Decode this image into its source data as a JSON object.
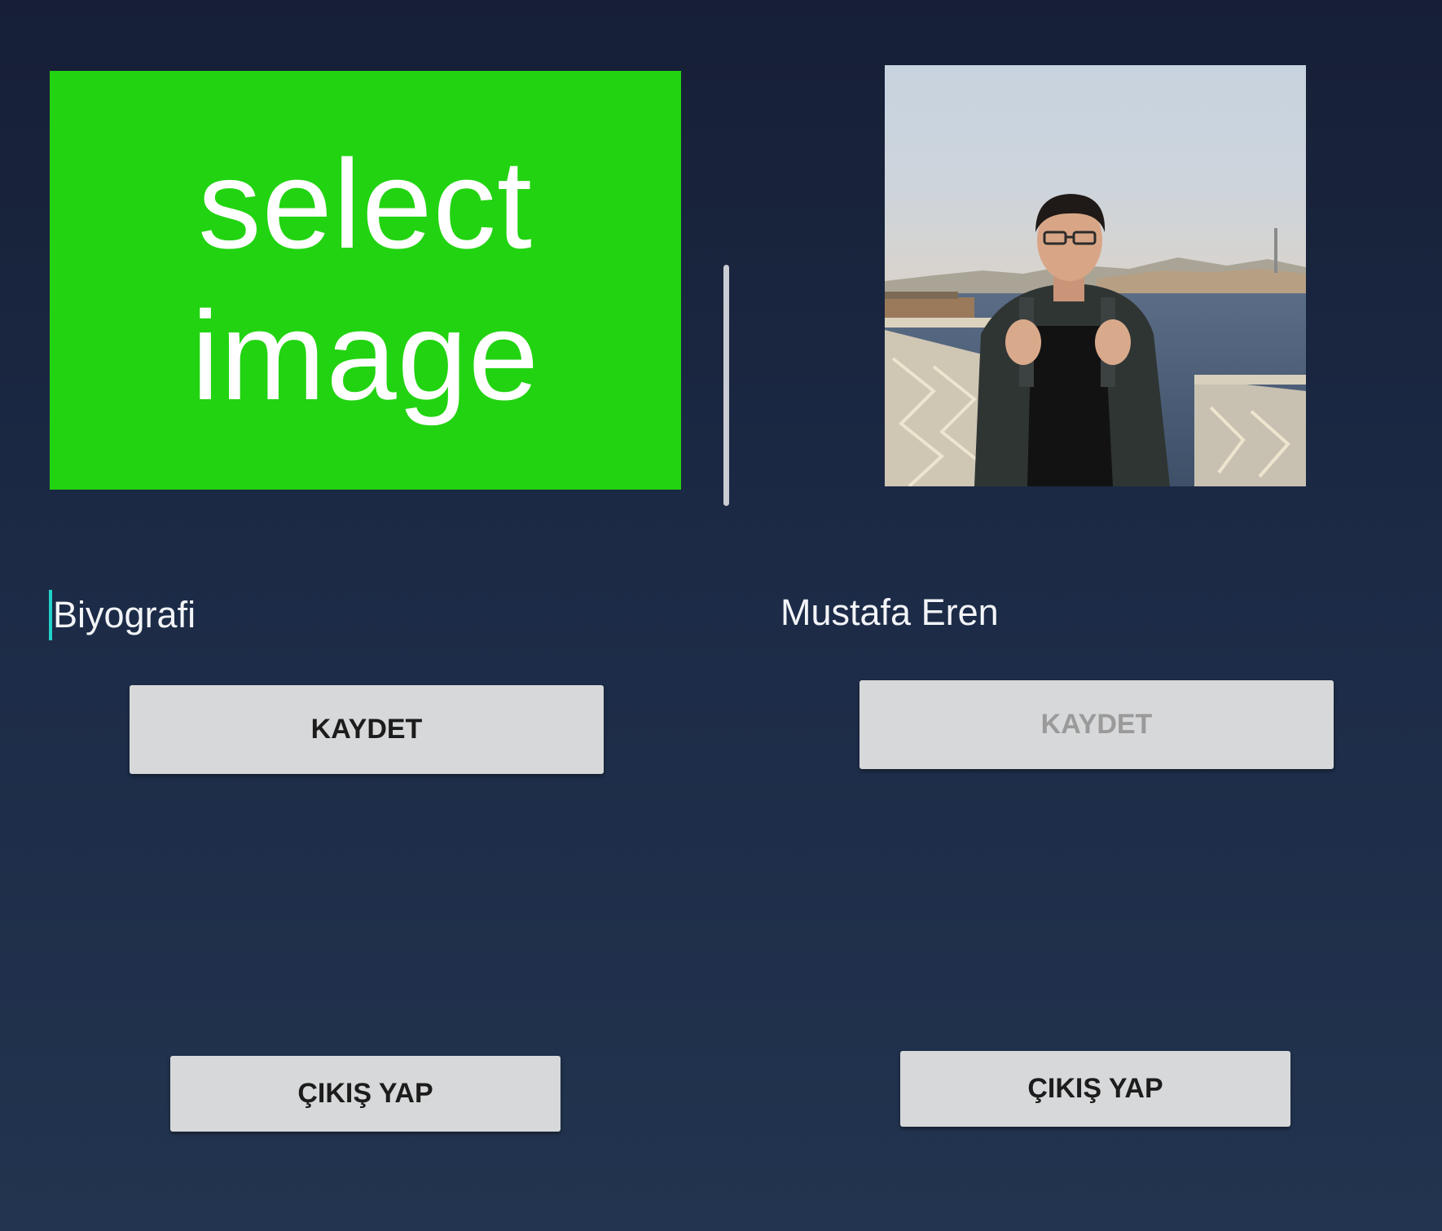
{
  "left_panel": {
    "select_image": {
      "line1": "select",
      "line2": "image",
      "background": "#22d311"
    },
    "bio_field": {
      "value": "Biyografi"
    },
    "save_label": "KAYDET",
    "logout_label": "ÇIKIŞ YAP"
  },
  "right_panel": {
    "profile_name": "Mustafa Eren",
    "save_label": "KAYDET",
    "save_enabled": false,
    "logout_label": "ÇIKIŞ YAP"
  },
  "colors": {
    "background_top": "#161f35",
    "background_bottom": "#22344f",
    "button_bg": "#d7d8d9",
    "cursor": "#1fd3c8"
  }
}
